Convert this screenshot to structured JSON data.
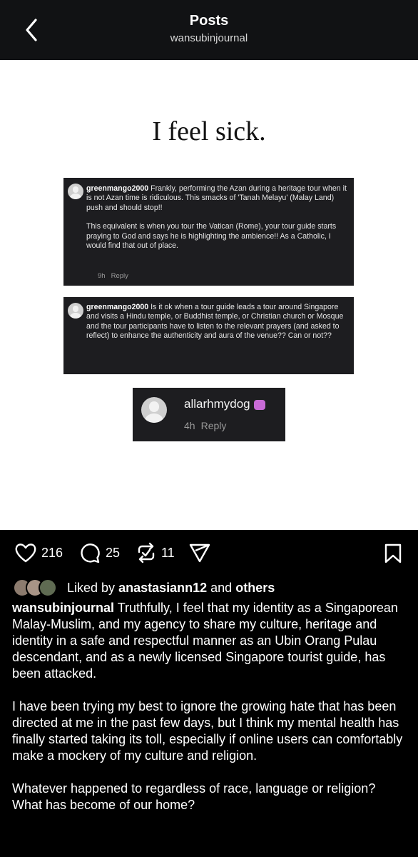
{
  "header": {
    "title": "Posts",
    "username": "wansubinjournal"
  },
  "post_image": {
    "headline": "I feel sick.",
    "comments": [
      {
        "user": "greenmango2000",
        "paragraphs": [
          "Frankly, performing the Azan during a heritage tour when it is not Azan time is ridiculous. This smacks of 'Tanah Melayu' (Malay Land) push and should stop!!",
          "This equivalent is when you tour the Vatican (Rome), your tour guide starts praying to God and says he is highlighting the ambience!! As a Catholic, I would find that out of place."
        ],
        "time": "9h",
        "reply": "Reply"
      },
      {
        "user": "greenmango2000",
        "paragraphs": [
          "Is it ok when a tour guide leads a tour around Singapore and visits a Hindu temple, or Buddhist temple, or Christian church or Mosque and the tour participants have to listen to the relevant prayers (and asked to reflect) to enhance the authenticity and aura of the venue?? Can or not??"
        ]
      },
      {
        "user": "allarhmydog",
        "time": "4h",
        "reply": "Reply",
        "emoji_icon": "smiling-devil-emoji"
      }
    ]
  },
  "actions": {
    "likes": "216",
    "comments": "25",
    "reposts": "11"
  },
  "liked_by": {
    "prefix": "Liked by",
    "user": "anastasiann12",
    "and": "and",
    "others": "others"
  },
  "caption": {
    "author": "wansubinjournal",
    "first": "Truthfully, I feel that my identity as a Singaporean Malay-Muslim, and my agency to share my culture, heritage and identity in a safe and respectful manner as an Ubin Orang Pulau descendant, and as a newly licensed Singapore tourist guide, has been attacked.",
    "second": "I have been trying my best to ignore the growing hate that has been directed at me in the past few days, but I think my mental health has finally started taking its toll, especially if online users can comfortably make a mockery of my culture and religion.",
    "third_line1": "Whatever happened to regardless of race, language or religion?",
    "third_line2": "What has become of our home?"
  }
}
